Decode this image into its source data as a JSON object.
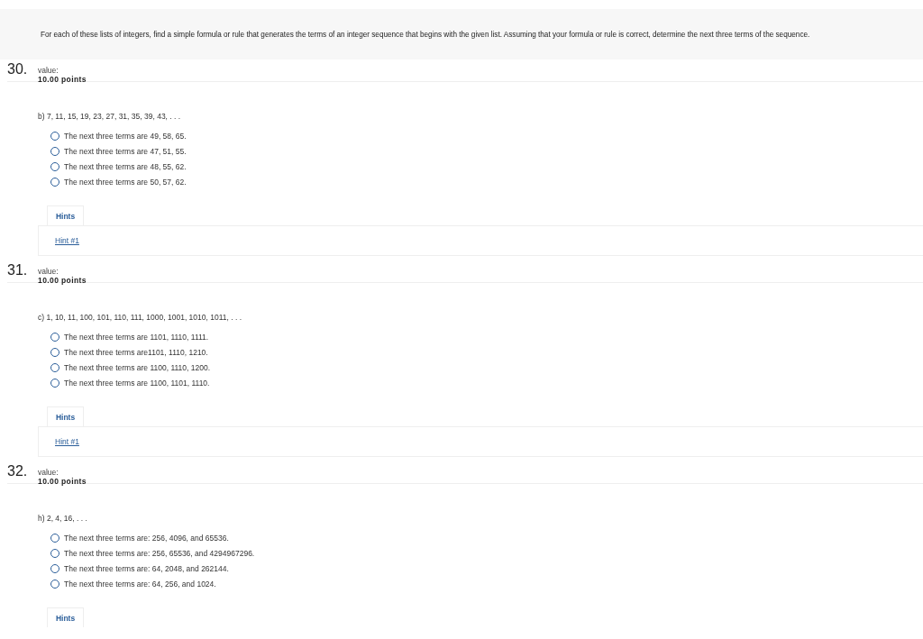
{
  "instructions": "For each of these lists of integers, find a simple formula or rule that generates the terms of an integer sequence that begins with the given list. Assuming that your formula or rule is correct, determine the next three terms of the sequence.",
  "questions": [
    {
      "number": "30.",
      "value_label": "value:",
      "points": "10.00 points",
      "prompt": "b) 7, 11, 15, 19, 23, 27, 31, 35, 39, 43, . . .",
      "options": [
        {
          "text": "The next three terms are 49, 58, 65.",
          "selected": false
        },
        {
          "text": "The next three terms are 47, 51, 55.",
          "selected": false
        },
        {
          "text": "The next three terms are 48, 55, 62.",
          "selected": false
        },
        {
          "text": "The next three terms are 50, 57, 62.",
          "selected": false
        }
      ],
      "hints_tab": "Hints",
      "hint_links": [
        "Hint #1"
      ]
    },
    {
      "number": "31.",
      "value_label": "value:",
      "points": "10.00 points",
      "prompt": "c) 1, 10, 11, 100, 101, 110, 111, 1000, 1001, 1010, 1011, . . .",
      "options": [
        {
          "text": "The next three terms are 1101, 1110, 1111.",
          "selected": false
        },
        {
          "text": "The next three terms are1101, 1110, 1210.",
          "selected": false
        },
        {
          "text": "The next three terms are 1100, 1110, 1200.",
          "selected": false
        },
        {
          "text": "The next three terms are 1100, 1101, 1110.",
          "selected": false
        }
      ],
      "hints_tab": "Hints",
      "hint_links": [
        "Hint #1"
      ]
    },
    {
      "number": "32.",
      "value_label": "value:",
      "points": "10.00 points",
      "prompt": "h) 2, 4, 16,  . . .",
      "options": [
        {
          "text": "The next three terms are: 256, 4096, and 65536.",
          "selected": false
        },
        {
          "text": "The next three terms are: 256, 65536, and 4294967296.",
          "selected": false
        },
        {
          "text": "The next three terms are: 64, 2048, and 262144.",
          "selected": false
        },
        {
          "text": "The next three terms are: 64, 256, and 1024.",
          "selected": false
        }
      ],
      "hints_tab": "Hints"
    }
  ]
}
